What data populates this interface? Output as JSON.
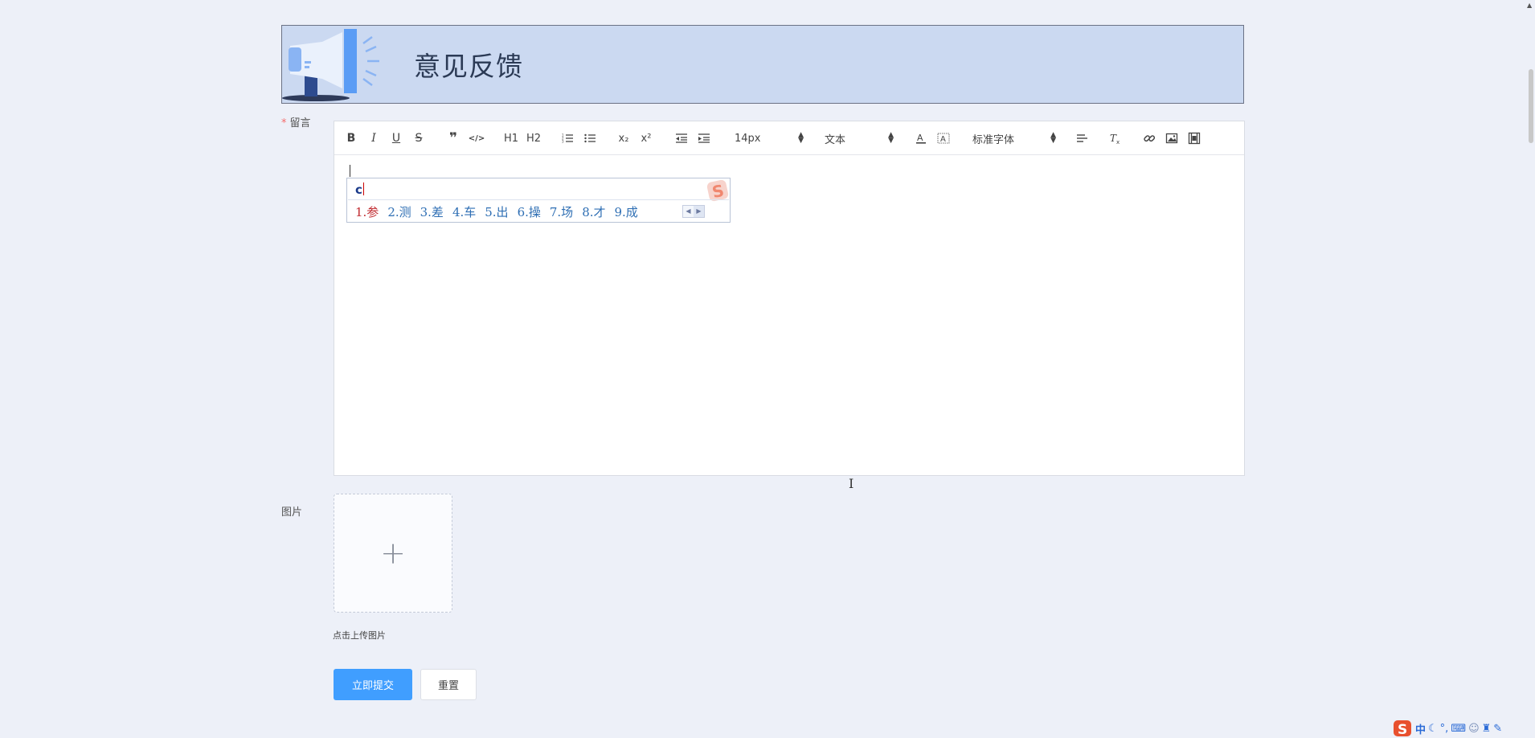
{
  "banner": {
    "title": "意见反馈",
    "icon": "megaphone-icon"
  },
  "form": {
    "message_label": "留言",
    "required_mark": "*",
    "image_label": "图片",
    "upload_hint": "点击上传图片",
    "submit_label": "立即提交",
    "reset_label": "重置"
  },
  "toolbar": {
    "bold": "B",
    "italic": "I",
    "underline": "U",
    "strike": "S",
    "quote": "❞",
    "code": "</>",
    "h1": "H1",
    "h2": "H2",
    "subscript": "x₂",
    "superscript": "x²",
    "size_value": "14px",
    "header_value": "文本",
    "font_value": "标准字体"
  },
  "ime": {
    "input": "c",
    "candidates": [
      "1.参",
      "2.测",
      "3.差",
      "4.车",
      "5.出",
      "6.操",
      "7.场",
      "8.才",
      "9.成"
    ]
  },
  "tray": {
    "mode": "中"
  },
  "colors": {
    "accent": "#409eff",
    "banner_bg": "#cbd9f1",
    "page_bg": "#edf0f8"
  }
}
